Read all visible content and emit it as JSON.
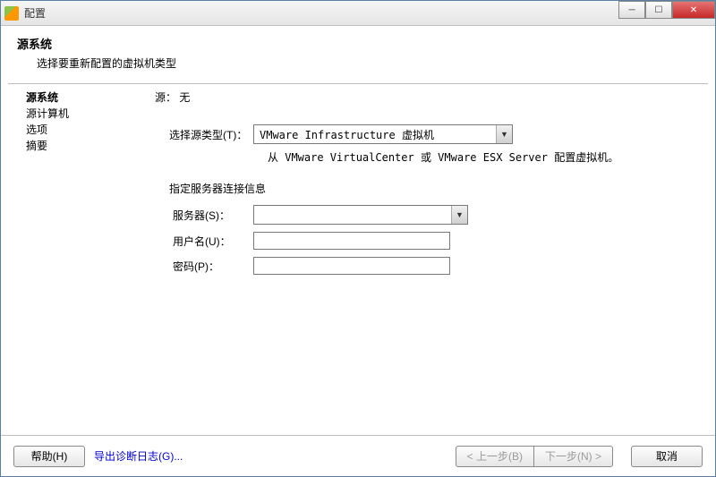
{
  "titlebar": {
    "title": "配置"
  },
  "header": {
    "title": "源系统",
    "subtitle": "选择要重新配置的虚拟机类型"
  },
  "sidebar": {
    "steps": [
      "源系统",
      "源计算机",
      "选项",
      "摘要"
    ]
  },
  "main": {
    "source_label": "源：",
    "source_value": "无",
    "select_type_label": "选择源类型(T)：",
    "select_type_value": "VMware Infrastructure 虚拟机",
    "hint": "从 VMware VirtualCenter 或 VMware ESX Server 配置虚拟机。",
    "group_label": "指定服务器连接信息",
    "server_label": "服务器(S)：",
    "server_value": "",
    "username_label": "用户名(U)：",
    "username_value": "",
    "password_label": "密码(P)：",
    "password_value": ""
  },
  "footer": {
    "help": "帮助(H)",
    "export_log": "导出诊断日志(G)...",
    "back": "< 上一步(B)",
    "next": "下一步(N) >",
    "cancel": "取消"
  }
}
